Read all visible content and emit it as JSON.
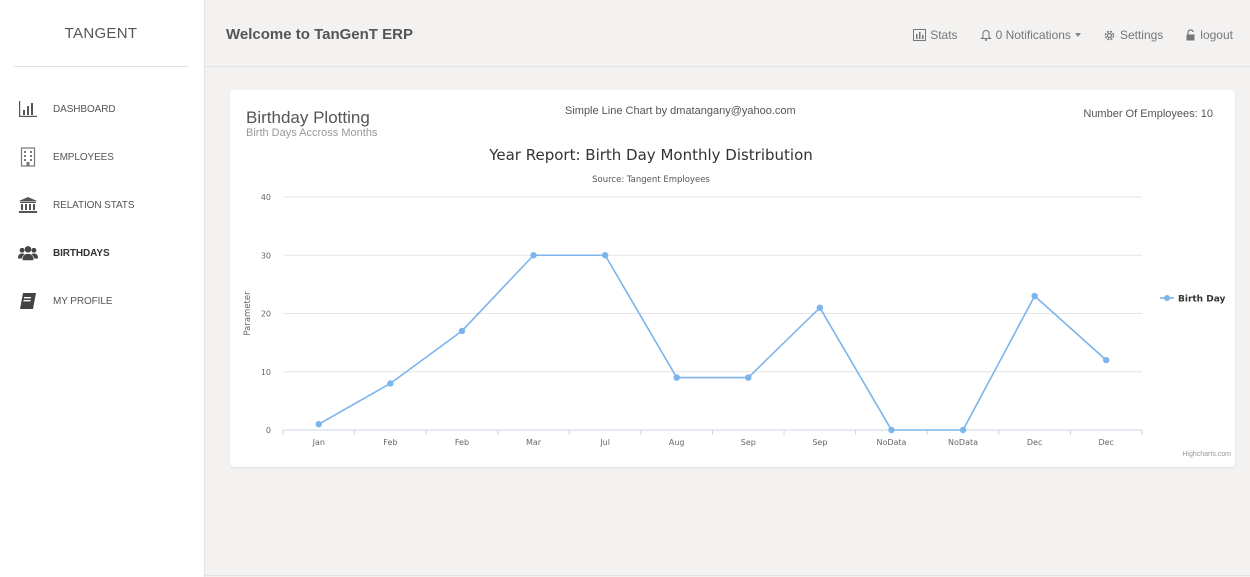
{
  "sidebar": {
    "brand": "TANGENT",
    "items": [
      {
        "label": "DASHBOARD",
        "icon": "bar-chart-icon"
      },
      {
        "label": "EMPLOYEES",
        "icon": "building-icon"
      },
      {
        "label": "RELATION STATS",
        "icon": "bank-icon"
      },
      {
        "label": "BIRTHDAYS",
        "icon": "users-icon"
      },
      {
        "label": "MY PROFILE",
        "icon": "book-icon"
      }
    ]
  },
  "header": {
    "welcome": "Welcome to TanGenT ERP",
    "stats": "Stats",
    "notifications": "0 Notifications",
    "settings": "Settings",
    "logout": "logout"
  },
  "card": {
    "title": "Birthday Plotting",
    "subtitle": "Birth Days Accross Months",
    "center_text": "Simple Line Chart by dmatangany@yahoo.com",
    "right_text": "Number Of Employees: 10",
    "credits": "Highcharts.com"
  },
  "colors": {
    "series": "#7cb5ec",
    "grid": "#e6e6e6",
    "background": "#f3f2f1"
  },
  "chart_data": {
    "type": "line",
    "title": "Year Report: Birth Day Monthly Distribution",
    "subtitle": "Source: Tangent Employees",
    "ylabel": "Parameter",
    "ylim": [
      0,
      40
    ],
    "yticks": [
      0,
      10,
      20,
      30,
      40
    ],
    "categories": [
      "Jan",
      "Feb",
      "Feb",
      "Mar",
      "Jul",
      "Aug",
      "Sep",
      "Sep",
      "NoData",
      "NoData",
      "Dec",
      "Dec"
    ],
    "series": [
      {
        "name": "Birth Day",
        "values": [
          1,
          8,
          17,
          30,
          30,
          9,
          9,
          21,
          0,
          0,
          23,
          12
        ]
      }
    ],
    "grid": true,
    "legend": "right"
  }
}
